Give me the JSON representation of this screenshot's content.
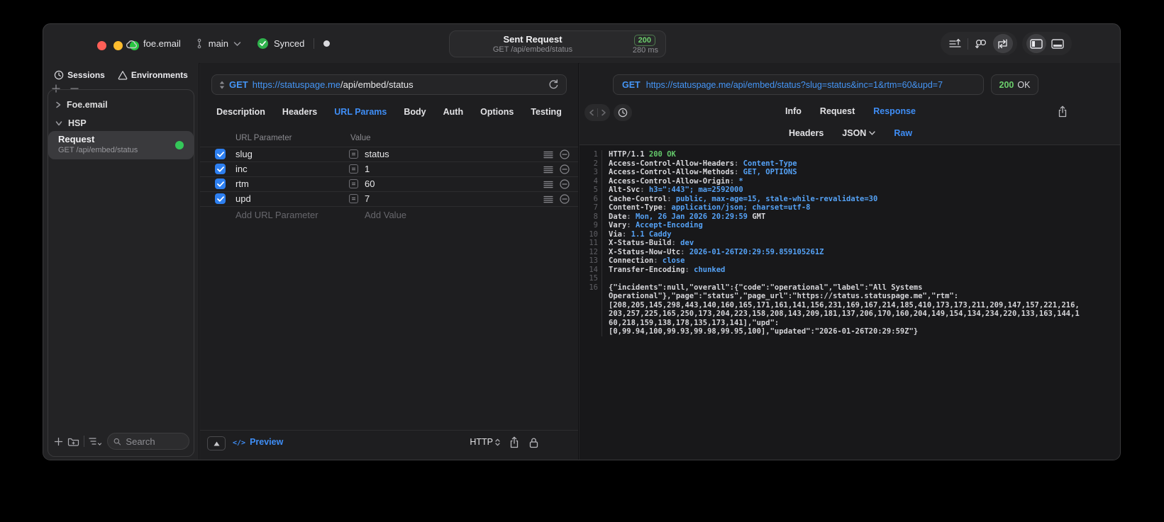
{
  "colors": {
    "accent_blue": "#4596f7",
    "success_green": "#63d36a",
    "checkbox_blue": "#2d7ff0",
    "status_dot_green": "#34c759"
  },
  "titlebar": {
    "account": "foe.email",
    "branch": "main",
    "sync_label": "Synced",
    "title": "Sent Request",
    "subtitle": "GET /api/embed/status",
    "status_badge": "200",
    "duration": "280 ms"
  },
  "sidebar": {
    "tabs": {
      "sessions": "Sessions",
      "environments": "Environments"
    },
    "tree": [
      {
        "label": "Foe.email",
        "expanded": false
      },
      {
        "label": "HSP",
        "expanded": true
      }
    ],
    "request_item": {
      "title": "Request",
      "subtitle": "GET /api/embed/status"
    },
    "search_placeholder": "Search"
  },
  "request_pane": {
    "method": "GET",
    "url_host": "https://statuspage.me",
    "url_path": "/api/embed/status",
    "tabs": [
      "Description",
      "Headers",
      "URL Params",
      "Body",
      "Auth",
      "Options",
      "Testing"
    ],
    "active_tab": "URL Params",
    "table": {
      "col_param": "URL Parameter",
      "col_value": "Value",
      "rows": [
        {
          "name": "slug",
          "value": "status",
          "checked": true
        },
        {
          "name": "inc",
          "value": "1",
          "checked": true
        },
        {
          "name": "rtm",
          "value": "60",
          "checked": true
        },
        {
          "name": "upd",
          "value": "7",
          "checked": true
        }
      ],
      "add_param": "Add URL Parameter",
      "add_value": "Add Value"
    },
    "footer": {
      "preview_label": "Preview",
      "protocol": "HTTP"
    }
  },
  "response_pane": {
    "method": "GET",
    "url": "https://statuspage.me/api/embed/status?slug=status&inc=1&rtm=60&upd=7",
    "status_code": "200",
    "status_text": "OK",
    "tabs": [
      "Info",
      "Request",
      "Response"
    ],
    "active_tab": "Response",
    "view_tabs": [
      {
        "label": "Headers",
        "chevron": false
      },
      {
        "label": "JSON",
        "chevron": true
      },
      {
        "label": "Raw",
        "chevron": false
      }
    ],
    "active_view": "Raw",
    "lines": [
      {
        "n": "1",
        "parts": [
          {
            "t": "HTTP/1.1 ",
            "c": "p"
          },
          {
            "t": "200 OK",
            "c": "g"
          }
        ]
      },
      {
        "n": "2",
        "parts": [
          {
            "t": "Access-Control-Allow-Headers",
            "c": "p"
          },
          {
            "t": ": ",
            "c": "d"
          },
          {
            "t": "Content-Type",
            "c": "b"
          }
        ]
      },
      {
        "n": "3",
        "parts": [
          {
            "t": "Access-Control-Allow-Methods",
            "c": "p"
          },
          {
            "t": ": ",
            "c": "d"
          },
          {
            "t": "GET, OPTIONS",
            "c": "b"
          }
        ]
      },
      {
        "n": "4",
        "parts": [
          {
            "t": "Access-Control-Allow-Origin",
            "c": "p"
          },
          {
            "t": ": ",
            "c": "d"
          },
          {
            "t": "*",
            "c": "b"
          }
        ]
      },
      {
        "n": "5",
        "parts": [
          {
            "t": "Alt-Svc",
            "c": "p"
          },
          {
            "t": ": ",
            "c": "d"
          },
          {
            "t": "h3=\":443\"; ma=2592000",
            "c": "b"
          }
        ]
      },
      {
        "n": "6",
        "parts": [
          {
            "t": "Cache-Control",
            "c": "p"
          },
          {
            "t": ": ",
            "c": "d"
          },
          {
            "t": "public, max-age=15, stale-while-revalidate=30",
            "c": "b"
          }
        ]
      },
      {
        "n": "7",
        "parts": [
          {
            "t": "Content-Type",
            "c": "p"
          },
          {
            "t": ": ",
            "c": "d"
          },
          {
            "t": "application/json; charset=utf-8",
            "c": "b"
          }
        ]
      },
      {
        "n": "8",
        "parts": [
          {
            "t": "Date",
            "c": "p"
          },
          {
            "t": ": ",
            "c": "d"
          },
          {
            "t": "Mon, 26 Jan 2026 20:29:59 ",
            "c": "b"
          },
          {
            "t": "GMT",
            "c": "p"
          }
        ]
      },
      {
        "n": "9",
        "parts": [
          {
            "t": "Vary",
            "c": "p"
          },
          {
            "t": ": ",
            "c": "d"
          },
          {
            "t": "Accept-Encoding",
            "c": "b"
          }
        ]
      },
      {
        "n": "10",
        "parts": [
          {
            "t": "Via",
            "c": "p"
          },
          {
            "t": ": ",
            "c": "d"
          },
          {
            "t": "1.1 Caddy",
            "c": "b"
          }
        ]
      },
      {
        "n": "11",
        "parts": [
          {
            "t": "X-Status-Build",
            "c": "p"
          },
          {
            "t": ": ",
            "c": "d"
          },
          {
            "t": "dev",
            "c": "b"
          }
        ]
      },
      {
        "n": "12",
        "parts": [
          {
            "t": "X-Status-Now-Utc",
            "c": "p"
          },
          {
            "t": ": ",
            "c": "d"
          },
          {
            "t": "2026-01-26T20:29:59.859105261Z",
            "c": "b"
          }
        ]
      },
      {
        "n": "13",
        "parts": [
          {
            "t": "Connection",
            "c": "p"
          },
          {
            "t": ": ",
            "c": "d"
          },
          {
            "t": "close",
            "c": "b"
          }
        ]
      },
      {
        "n": "14",
        "parts": [
          {
            "t": "Transfer-Encoding",
            "c": "p"
          },
          {
            "t": ": ",
            "c": "d"
          },
          {
            "t": "chunked",
            "c": "b"
          }
        ]
      },
      {
        "n": "15",
        "parts": []
      },
      {
        "n": "16",
        "parts": [
          {
            "t": "{\"incidents\":null,\"overall\":{\"code\":\"operational\",\"label\":\"All Systems",
            "c": "p"
          }
        ]
      },
      {
        "n": "",
        "parts": [
          {
            "t": "Operational\"},\"page\":\"status\",\"page_url\":\"https://status.statuspage.me\",\"rtm\":",
            "c": "p"
          }
        ]
      },
      {
        "n": "",
        "parts": [
          {
            "t": "[208,205,145,298,443,140,160,165,171,161,141,156,231,169,167,214,185,410,173,173,211,209,147,157,221,216,",
            "c": "p"
          }
        ]
      },
      {
        "n": "",
        "parts": [
          {
            "t": "203,257,225,165,250,173,204,223,158,208,143,209,181,137,206,170,160,204,149,154,134,234,220,133,163,144,1",
            "c": "p"
          }
        ]
      },
      {
        "n": "",
        "parts": [
          {
            "t": "60,218,159,138,178,135,173,141],\"upd\":",
            "c": "p"
          }
        ]
      },
      {
        "n": "",
        "parts": [
          {
            "t": "[0,99.94,100,99.93,99.98,99.95,100],\"updated\":\"2026-01-26T20:29:59Z\"}",
            "c": "p"
          }
        ]
      }
    ]
  }
}
